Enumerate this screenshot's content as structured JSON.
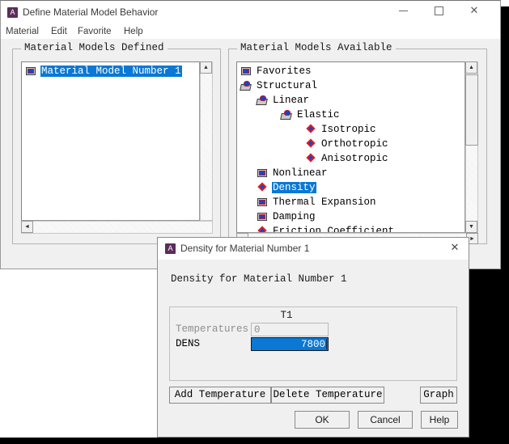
{
  "main_window": {
    "title": "Define Material Model Behavior",
    "logo_letter": "A",
    "window_controls": {
      "minimize": "minimize-icon",
      "maximize": "maximize-icon",
      "close": "✕"
    },
    "menus": [
      {
        "label": "Material"
      },
      {
        "label": "Edit"
      },
      {
        "label": "Favorite"
      },
      {
        "label": "Help"
      }
    ],
    "defined_group": {
      "title": "Material Models Defined",
      "items": [
        {
          "label": "Material Model Number 1",
          "icon": "box-folder-icon",
          "indent": 0,
          "selected": true
        }
      ]
    },
    "available_group": {
      "title": "Material Models Available",
      "items": [
        {
          "label": "Favorites",
          "icon": "box-folder-icon",
          "indent": 0,
          "selected": false
        },
        {
          "label": "Structural",
          "icon": "open-folder-icon",
          "indent": 0,
          "selected": false
        },
        {
          "label": "Linear",
          "icon": "open-folder-icon",
          "indent": 1,
          "selected": false
        },
        {
          "label": "Elastic",
          "icon": "open-folder-icon",
          "indent": 2,
          "selected": false
        },
        {
          "label": "Isotropic",
          "icon": "gem-icon",
          "indent": 3,
          "selected": false
        },
        {
          "label": "Orthotropic",
          "icon": "gem-icon",
          "indent": 3,
          "selected": false
        },
        {
          "label": "Anisotropic",
          "icon": "gem-icon",
          "indent": 3,
          "selected": false
        },
        {
          "label": "Nonlinear",
          "icon": "box-folder-icon",
          "indent": 1,
          "selected": false
        },
        {
          "label": "Density",
          "icon": "gem-icon",
          "indent": 1,
          "selected": true
        },
        {
          "label": "Thermal Expansion",
          "icon": "box-folder-icon",
          "indent": 1,
          "selected": false
        },
        {
          "label": "Damping",
          "icon": "box-folder-icon",
          "indent": 1,
          "selected": false
        },
        {
          "label": "Friction Coefficient",
          "icon": "gem-icon",
          "indent": 1,
          "selected": false
        }
      ]
    },
    "scroll_glyphs": {
      "up": "▲",
      "down": "▼",
      "left": "◄",
      "right": "►"
    }
  },
  "dialog": {
    "title": "Density for Material Number 1",
    "logo_letter": "A",
    "close_glyph": "✕",
    "heading": "Density for Material Number 1",
    "table": {
      "column_headers": [
        "T1"
      ],
      "rows": [
        {
          "label": "Temperatures",
          "value": "0",
          "selected": false
        },
        {
          "label": "DENS",
          "value": "7800",
          "selected": true
        }
      ]
    },
    "buttons": {
      "add_temperature": "Add Temperature",
      "delete_temperature": "Delete Temperature",
      "graph": "Graph",
      "ok": "OK",
      "cancel": "Cancel",
      "help": "Help"
    }
  },
  "colors": {
    "selection_blue": "#0a78d4",
    "ansys_purple": "#5b2d5b",
    "window_face": "#f0f0f0",
    "backdrop": "#000000"
  }
}
